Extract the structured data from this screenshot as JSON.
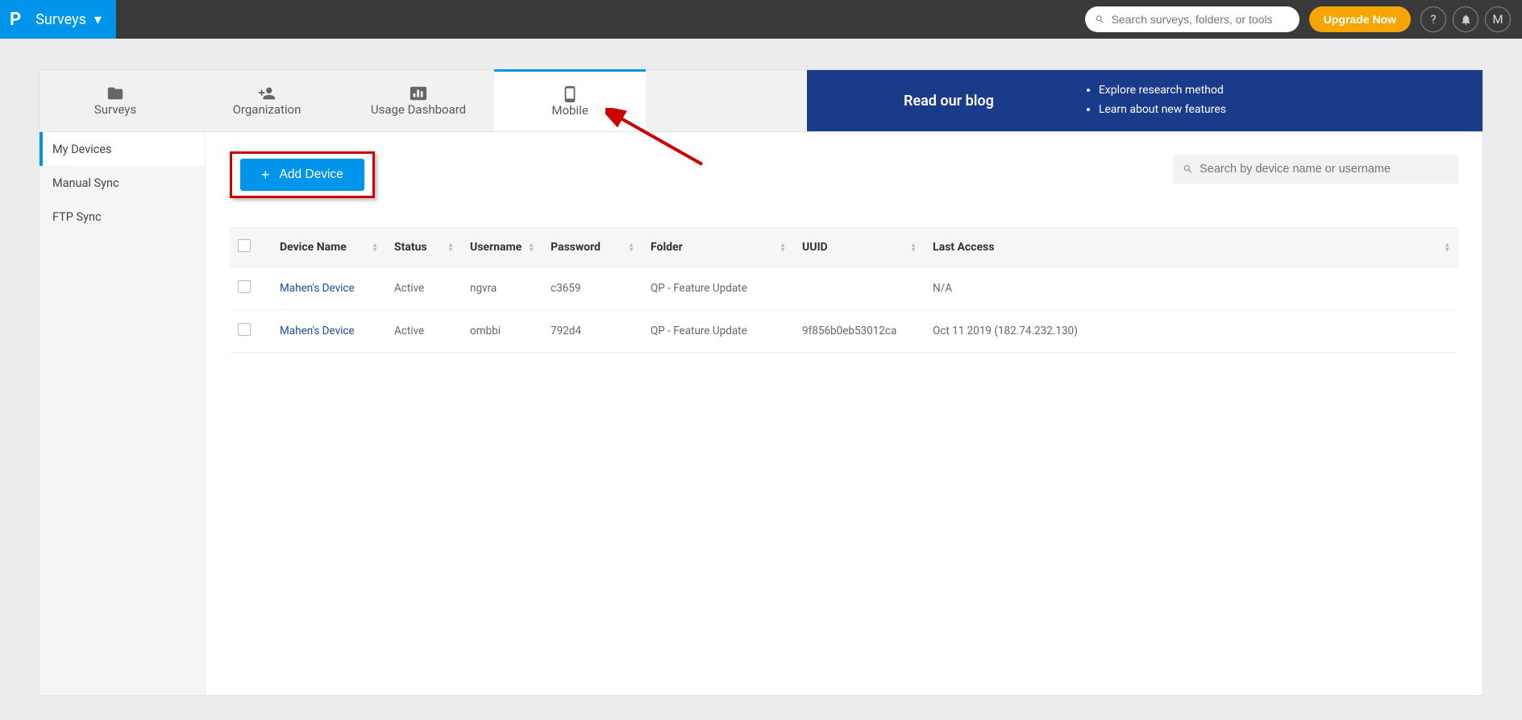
{
  "topbar": {
    "product_label": "Surveys",
    "global_search_placeholder": "Search surveys, folders, or tools",
    "upgrade_label": "Upgrade Now",
    "avatar_letter": "M"
  },
  "tabs": {
    "surveys": "Surveys",
    "organization": "Organization",
    "usage_dashboard": "Usage Dashboard",
    "mobile": "Mobile"
  },
  "blog": {
    "title": "Read our blog",
    "item1": "Explore research method",
    "item2": "Learn about new features"
  },
  "sidebar": {
    "my_devices": "My Devices",
    "manual_sync": "Manual Sync",
    "ftp_sync": "FTP Sync"
  },
  "actions": {
    "add_device": "Add Device",
    "device_search_placeholder": "Search by device name or username"
  },
  "columns": {
    "device_name": "Device Name",
    "status": "Status",
    "username": "Username",
    "password": "Password",
    "folder": "Folder",
    "uuid": "UUID",
    "last_access": "Last Access"
  },
  "rows": [
    {
      "device_name": "Mahen's Device",
      "status": "Active",
      "username": "ngvra",
      "password": "c3659",
      "folder": "QP - Feature Update",
      "uuid": "",
      "last_access": "N/A"
    },
    {
      "device_name": "Mahen's Device",
      "status": "Active",
      "username": "ombbi",
      "password": "792d4",
      "folder": "QP - Feature Update",
      "uuid": "9f856b0eb53012ca",
      "last_access": "Oct 11 2019 (182.74.232.130)"
    }
  ]
}
